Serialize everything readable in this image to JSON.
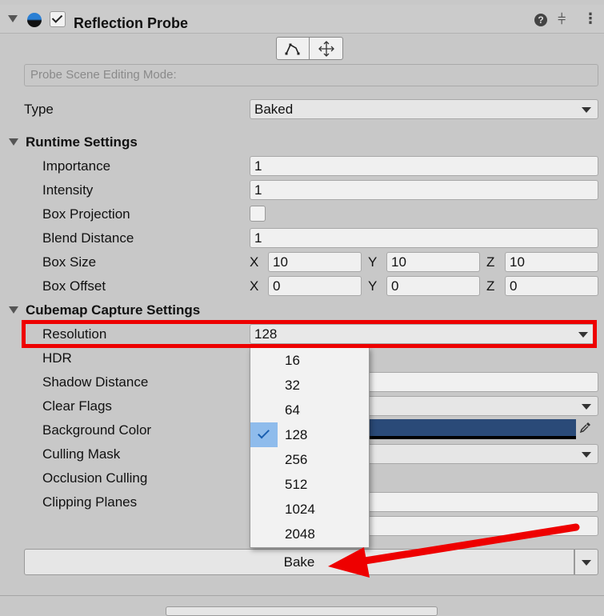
{
  "component": {
    "title": "Reflection Probe",
    "enabled": true,
    "icons": [
      "reflection-probe-icon",
      "help-icon",
      "preset-sliders-icon",
      "more-options-icon"
    ]
  },
  "toolbar": {
    "buttons": [
      "edit-bounds-icon",
      "move-gizmo-icon"
    ]
  },
  "mode_label": "Probe Scene Editing Mode:",
  "type": {
    "label": "Type",
    "value": "Baked"
  },
  "runtime": {
    "header": "Runtime Settings",
    "importance": {
      "label": "Importance",
      "value": "1"
    },
    "intensity": {
      "label": "Intensity",
      "value": "1"
    },
    "box_projection": {
      "label": "Box Projection",
      "checked": false
    },
    "blend_distance": {
      "label": "Blend Distance",
      "value": "1"
    },
    "box_size": {
      "label": "Box Size",
      "x": "10",
      "y": "10",
      "z": "10"
    },
    "box_offset": {
      "label": "Box Offset",
      "x": "0",
      "y": "0",
      "z": "0"
    }
  },
  "axes": {
    "x": "X",
    "y": "Y",
    "z": "Z"
  },
  "cubemap": {
    "header": "Cubemap Capture Settings",
    "resolution": {
      "label": "Resolution",
      "value": "128"
    },
    "hdr": {
      "label": "HDR"
    },
    "shadow_distance": {
      "label": "Shadow Distance"
    },
    "clear_flags": {
      "label": "Clear Flags"
    },
    "background_color": {
      "label": "Background Color",
      "color": "#2a4a78"
    },
    "culling_mask": {
      "label": "Culling Mask"
    },
    "occlusion_culling": {
      "label": "Occlusion Culling"
    },
    "clipping_planes": {
      "label": "Clipping Planes"
    }
  },
  "resolution_menu": {
    "options": [
      "16",
      "32",
      "64",
      "128",
      "256",
      "512",
      "1024",
      "2048"
    ],
    "selected": "128"
  },
  "bake_button": {
    "label": "Bake"
  },
  "annotation": {
    "highlight_color": "#ee0000",
    "arrow_color": "#ee0000"
  }
}
